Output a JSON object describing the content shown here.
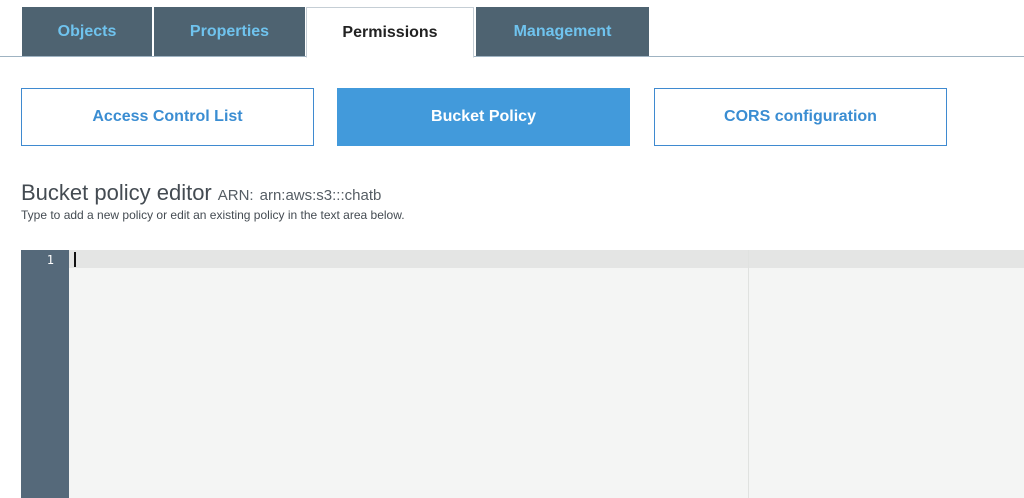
{
  "tabs": {
    "objects": "Objects",
    "properties": "Properties",
    "permissions": "Permissions",
    "management": "Management",
    "active": "Permissions"
  },
  "subtabs": {
    "acl": "Access Control List",
    "policy": "Bucket Policy",
    "cors": "CORS configuration",
    "active": "Bucket Policy"
  },
  "editor": {
    "title": "Bucket policy editor",
    "arn_label": "ARN:",
    "arn_value": "arn:aws:s3:::chatb",
    "subtitle": "Type to add a new policy or edit an existing policy in the text area below.",
    "line_numbers": [
      "1"
    ],
    "content": ""
  },
  "colors": {
    "tab_bg": "#4e6371",
    "tab_text": "#6fc3ee",
    "accent": "#429adb",
    "gutter": "#55697a"
  }
}
